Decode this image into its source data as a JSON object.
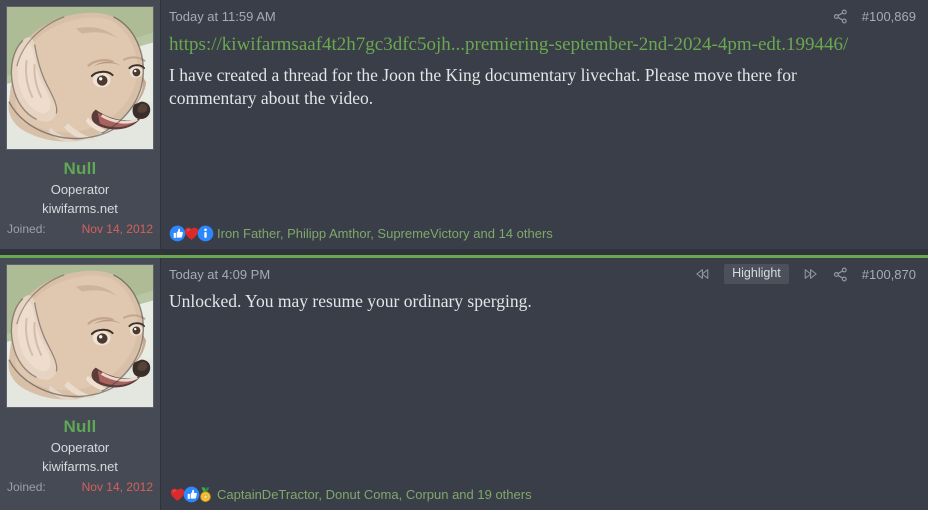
{
  "theme": {
    "page_bg": "#2f333b",
    "post_bg": "#3a3e48",
    "sidebar_bg": "#454a55",
    "accent_green": "#6aa84f",
    "username_green": "#5fa855",
    "reaction_text_green": "#7fa86b",
    "joined_date_red": "#d4615b",
    "muted_text": "#a7abb4",
    "highlight_btn_bg": "#4b505b"
  },
  "posts": [
    {
      "id": "post-100869",
      "highlighted": false,
      "timestamp": "Today at 11:59 AM",
      "post_number": "#100,869",
      "tools": [
        {
          "name": "share-icon",
          "label": "share"
        }
      ],
      "link_text": "https://kiwifarmsaaf4t2h7gc3dfc5ojh...premiering-september-2nd-2024-4pm-edt.199446/",
      "body_text": "I have created a thread for the Joon the King documentary livechat. Please move there for commentary about the video.",
      "user": {
        "name": "Null",
        "title": "Ooperator",
        "site": "kiwifarms.net",
        "joined_label": "Joined:",
        "joined_date": "Nov 14, 2012",
        "avatar_alt": "dog-illustration-avatar"
      },
      "reactions": {
        "icons": [
          "thumbs-up-icon",
          "heart-icon",
          "info-icon"
        ],
        "names": "Iron Father, Philipp Amthor, SupremeVictory and 14 others"
      }
    },
    {
      "id": "post-100870",
      "highlighted": true,
      "timestamp": "Today at 4:09 PM",
      "post_number": "#100,870",
      "tools": [
        {
          "name": "skip-backward-icon",
          "label": "previous"
        },
        {
          "name": "highlight-button",
          "label": "Highlight"
        },
        {
          "name": "skip-forward-icon",
          "label": "next"
        },
        {
          "name": "share-icon",
          "label": "share"
        }
      ],
      "link_text": "",
      "body_text": "Unlocked. You may resume your ordinary sperging.",
      "user": {
        "name": "Null",
        "title": "Ooperator",
        "site": "kiwifarms.net",
        "joined_label": "Joined:",
        "joined_date": "Nov 14, 2012",
        "avatar_alt": "dog-illustration-avatar"
      },
      "reactions": {
        "icons": [
          "heart-icon",
          "thumbs-up-icon",
          "medal-icon"
        ],
        "names": "CaptainDeTractor, Donut Coma, Corpun and 19 others"
      }
    }
  ]
}
